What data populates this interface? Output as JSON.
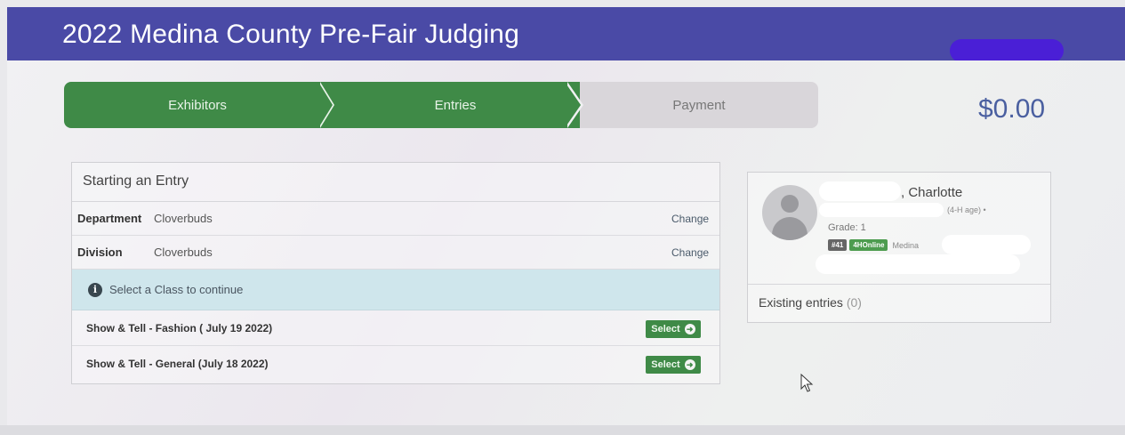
{
  "header": {
    "title": "2022 Medina County Pre-Fair Judging"
  },
  "wizard": {
    "steps": [
      {
        "label": "Exhibitors",
        "state": "complete"
      },
      {
        "label": "Entries",
        "state": "active"
      },
      {
        "label": "Payment",
        "state": "pending"
      }
    ],
    "total": "$0.00"
  },
  "entry": {
    "heading": "Starting an Entry",
    "fields": [
      {
        "label": "Department",
        "value": "Cloverbuds",
        "action": "Change"
      },
      {
        "label": "Division",
        "value": "Cloverbuds",
        "action": "Change"
      }
    ],
    "notice": "Select a Class to continue",
    "classes": [
      {
        "name": "Show & Tell - Fashion ( July 19 2022)",
        "action": "Select"
      },
      {
        "name": "Show & Tell - General (July 18 2022)",
        "action": "Select"
      }
    ]
  },
  "exhibitor": {
    "name_suffix": ", Charlotte",
    "age_text": "(4-H age) •",
    "grade": "Grade: 1",
    "badges": [
      "#41",
      "4HOnline"
    ],
    "county": "Medina",
    "existing_label": "Existing entries",
    "existing_count": "(0)"
  },
  "colors": {
    "header_bg": "#4a4aa6",
    "step_active": "#3f8a47",
    "step_pending": "#d9d6da",
    "total_text": "#4a5fa0",
    "info_bg": "#cfe6ec"
  },
  "icons": {
    "info": "info-circle-icon",
    "select": "arrow-circle-right-icon",
    "avatar": "user-placeholder-icon",
    "cursor": "mouse-pointer-icon"
  }
}
